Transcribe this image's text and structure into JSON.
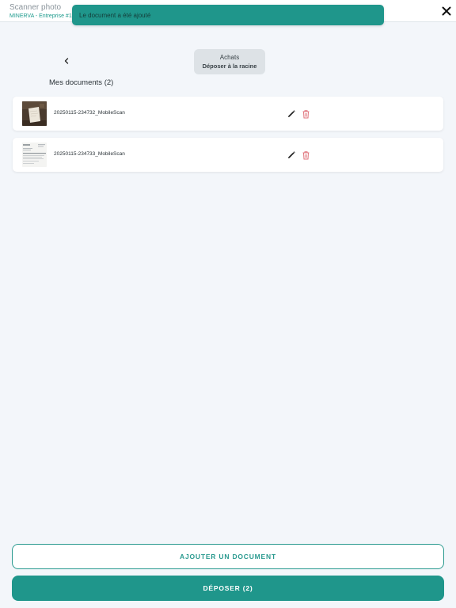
{
  "header": {
    "title": "Scanner photo",
    "company": "MINERVA - Entreprise #1"
  },
  "toast": {
    "message": "Le document a été ajouté"
  },
  "folder": {
    "name": "Achats",
    "action": "Déposer à la racine"
  },
  "documents": {
    "title": "Mes documents (2)",
    "items": [
      {
        "name": "20250115-234732_MobileScan",
        "thumbnail": "photo-thumbnail"
      },
      {
        "name": "20250115-234733_MobileScan",
        "thumbnail": "document-thumbnail"
      }
    ]
  },
  "buttons": {
    "add_label": "AJOUTER UN DOCUMENT",
    "submit_label": "DÉPOSER (2)"
  },
  "icons": {
    "close": "close-icon",
    "back": "chevron-left-icon",
    "edit": "pencil-icon",
    "delete": "trash-icon"
  },
  "colors": {
    "accent": "#1f968b",
    "delete": "#e0737b",
    "background": "#f3f6fa"
  }
}
